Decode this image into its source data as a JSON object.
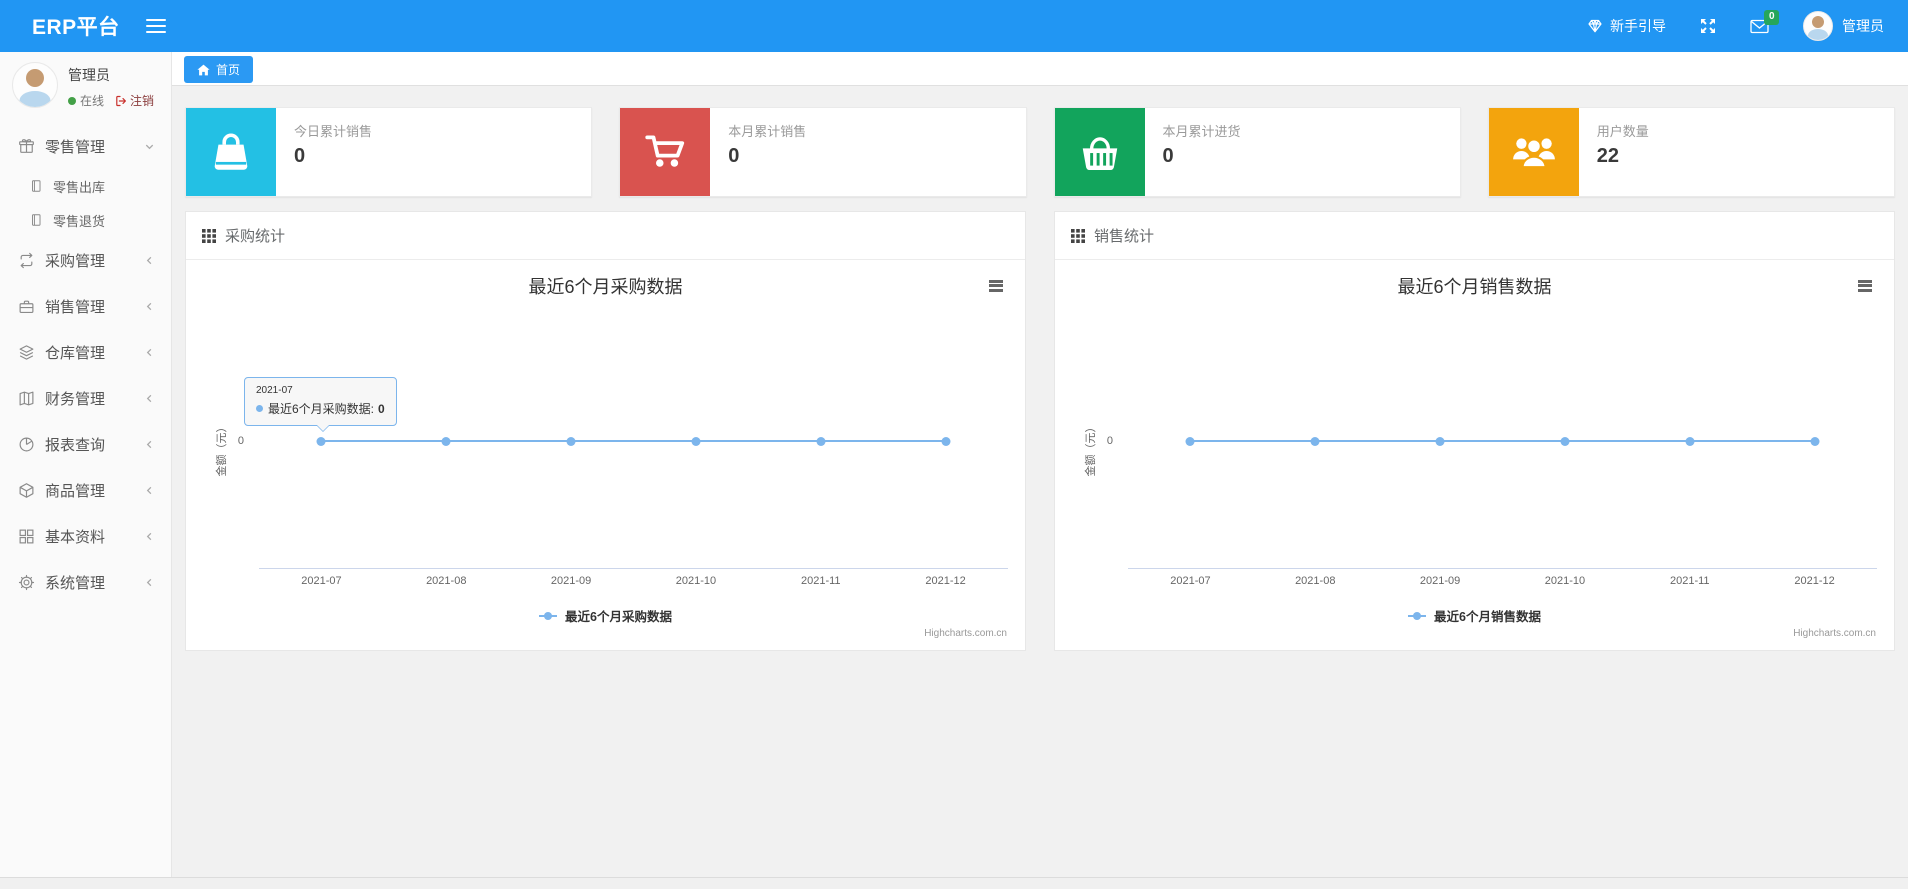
{
  "navbar": {
    "brand": "ERP平台",
    "guide_label": "新手引导",
    "messages_badge": "0",
    "username": "管理员"
  },
  "sidebar": {
    "user": {
      "name": "管理员",
      "status_online": "在线",
      "logout_label": "注销"
    },
    "menu": [
      {
        "label": "零售管理",
        "icon": "gift-icon",
        "state": "expanded"
      },
      {
        "label": "零售出库",
        "icon": "file-icon",
        "child": true
      },
      {
        "label": "零售退货",
        "icon": "file-icon",
        "child": true
      },
      {
        "label": "采购管理",
        "icon": "exchange-icon"
      },
      {
        "label": "销售管理",
        "icon": "briefcase-icon"
      },
      {
        "label": "仓库管理",
        "icon": "layers-icon"
      },
      {
        "label": "财务管理",
        "icon": "map-icon"
      },
      {
        "label": "报表查询",
        "icon": "pie-chart-icon"
      },
      {
        "label": "商品管理",
        "icon": "cube-icon"
      },
      {
        "label": "基本资料",
        "icon": "grid-icon"
      },
      {
        "label": "系统管理",
        "icon": "gear-icon"
      }
    ]
  },
  "tabbar": {
    "home_tab": "首页"
  },
  "stat_cards": [
    {
      "label": "今日累计销售",
      "value": "0",
      "color": "#23c0e4",
      "icon": "shopping-bag-icon"
    },
    {
      "label": "本月累计销售",
      "value": "0",
      "color": "#d9534f",
      "icon": "shopping-cart-icon"
    },
    {
      "label": "本月累计进货",
      "value": "0",
      "color": "#12a45c",
      "icon": "shopping-basket-icon"
    },
    {
      "label": "用户数量",
      "value": "22",
      "color": "#f3a40d",
      "icon": "users-icon"
    }
  ],
  "panels": [
    {
      "header": "采购统计",
      "tooltip": {
        "header": "2021-07",
        "series_label": "最近6个月采购数据:",
        "value": "0"
      }
    },
    {
      "header": "销售统计"
    }
  ],
  "credits": "Highcharts.com.cn",
  "colors": {
    "navbar_blue": "#2196f3",
    "series_line": "#7cb5ec",
    "badge_green": "#26a65b",
    "online_green": "#43a047"
  },
  "chart_data": [
    {
      "type": "line",
      "title": "最近6个月采购数据",
      "x": [
        "2021-07",
        "2021-08",
        "2021-09",
        "2021-10",
        "2021-11",
        "2021-12"
      ],
      "series": [
        {
          "name": "最近6个月采购数据",
          "values": [
            0,
            0,
            0,
            0,
            0,
            0
          ]
        }
      ],
      "ylabel": "金额（元）",
      "yticks": [
        "0"
      ],
      "ylim": [
        -1,
        1
      ],
      "grid": false,
      "legend_position": "bottom",
      "line_color": "#7cb5ec"
    },
    {
      "type": "line",
      "title": "最近6个月销售数据",
      "x": [
        "2021-07",
        "2021-08",
        "2021-09",
        "2021-10",
        "2021-11",
        "2021-12"
      ],
      "series": [
        {
          "name": "最近6个月销售数据",
          "values": [
            0,
            0,
            0,
            0,
            0,
            0
          ]
        }
      ],
      "ylabel": "金额（元）",
      "yticks": [
        "0"
      ],
      "ylim": [
        -1,
        1
      ],
      "grid": false,
      "legend_position": "bottom",
      "line_color": "#7cb5ec"
    }
  ]
}
